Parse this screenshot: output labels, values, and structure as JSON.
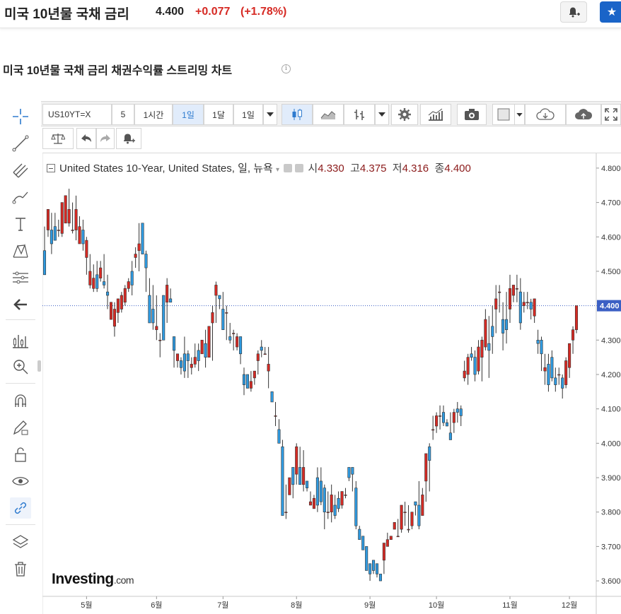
{
  "header": {
    "title": "미국 10년물 국채 금리",
    "price": "4.400",
    "change": "+0.077",
    "change_pct": "(+1.78%)"
  },
  "section": {
    "title": "미국 10년물 국채 금리 채권수익률 스트리밍 차트"
  },
  "toolbar": {
    "symbol": "US10YT=X",
    "interval_5": "5",
    "interval_1h": "1시간",
    "interval_1d": "1일",
    "interval_1m": "1달",
    "range": "1일"
  },
  "legend": {
    "instrument": "United States 10-Year, United States, 일, 뉴욕",
    "open_label": "시",
    "open": "4.330",
    "high_label": "고",
    "high": "4.375",
    "low_label": "저",
    "low": "4.316",
    "close_label": "종",
    "close": "4.400"
  },
  "watermark": {
    "brand": "Investing",
    "domain": ".com"
  },
  "colors": {
    "up": "#d62a24",
    "down": "#2f9ae0",
    "accent": "#1a64c8"
  },
  "chart_data": {
    "type": "candlestick",
    "title": "",
    "ylim": [
      3.555,
      4.845
    ],
    "y_ticks": [
      "3.600",
      "3.700",
      "3.800",
      "3.900",
      "4.000",
      "4.100",
      "4.200",
      "4.300",
      "4.400",
      "4.500",
      "4.600",
      "4.700",
      "4.800"
    ],
    "x_ticks": [
      {
        "label": "5월",
        "index": 12
      },
      {
        "label": "6월",
        "index": 32
      },
      {
        "label": "7월",
        "index": 51
      },
      {
        "label": "8월",
        "index": 72
      },
      {
        "label": "9월",
        "index": 93
      },
      {
        "label": "10월",
        "index": 112
      },
      {
        "label": "11월",
        "index": 133
      },
      {
        "label": "12월",
        "index": 150
      }
    ],
    "last_price": "4.400",
    "series": [
      {
        "ohlc": [
          [
            4.56,
            4.63,
            4.49,
            4.49
          ],
          [
            4.62,
            4.68,
            4.6,
            4.68
          ],
          [
            4.62,
            4.67,
            4.55,
            4.58
          ],
          [
            4.63,
            4.67,
            4.59,
            4.59
          ],
          [
            4.62,
            4.65,
            4.6,
            4.62
          ],
          [
            4.61,
            4.7,
            4.6,
            4.7
          ],
          [
            4.64,
            4.72,
            4.64,
            4.72
          ],
          [
            4.64,
            4.74,
            4.63,
            4.68
          ],
          [
            4.62,
            4.7,
            4.61,
            4.62
          ],
          [
            4.62,
            4.72,
            4.59,
            4.68
          ],
          [
            4.58,
            4.66,
            4.58,
            4.63
          ],
          [
            4.62,
            4.65,
            4.56,
            4.58
          ],
          [
            4.54,
            4.6,
            4.49,
            4.59
          ],
          [
            4.46,
            4.55,
            4.45,
            4.5
          ],
          [
            4.45,
            4.52,
            4.44,
            4.48
          ],
          [
            4.49,
            4.53,
            4.44,
            4.45
          ],
          [
            4.48,
            4.53,
            4.47,
            4.51
          ],
          [
            4.47,
            4.55,
            4.45,
            4.46
          ],
          [
            4.44,
            4.49,
            4.39,
            4.43
          ],
          [
            4.36,
            4.41,
            4.36,
            4.41
          ],
          [
            4.34,
            4.41,
            4.31,
            4.39
          ],
          [
            4.38,
            4.42,
            4.35,
            4.42
          ],
          [
            4.39,
            4.44,
            4.38,
            4.43
          ],
          [
            4.41,
            4.46,
            4.4,
            4.45
          ],
          [
            4.45,
            4.48,
            4.44,
            4.47
          ],
          [
            4.5,
            4.53,
            4.43,
            4.46
          ],
          [
            4.54,
            4.57,
            4.51,
            4.55
          ],
          [
            4.56,
            4.64,
            4.5,
            4.58
          ],
          [
            4.64,
            4.6,
            4.59,
            4.55
          ],
          [
            4.55,
            4.56,
            4.44,
            4.51
          ],
          [
            4.43,
            4.48,
            4.35,
            4.35
          ],
          [
            4.39,
            4.46,
            4.33,
            4.35
          ],
          [
            4.33,
            4.43,
            4.3,
            4.34
          ],
          [
            4.3,
            4.32,
            4.25,
            4.3
          ],
          [
            4.43,
            4.38,
            4.37,
            4.3
          ],
          [
            4.41,
            4.48,
            4.35,
            4.46
          ],
          [
            4.42,
            4.45,
            4.41,
            4.41
          ],
          [
            4.31,
            4.31,
            4.22,
            4.27
          ],
          [
            4.24,
            4.26,
            4.22,
            4.26
          ],
          [
            4.24,
            4.25,
            4.2,
            4.22
          ],
          [
            4.26,
            4.31,
            4.19,
            4.21
          ],
          [
            4.26,
            4.27,
            4.19,
            4.24
          ],
          [
            4.22,
            4.25,
            4.2,
            4.23
          ],
          [
            4.23,
            4.29,
            4.22,
            4.25
          ],
          [
            4.27,
            4.29,
            4.21,
            4.24
          ],
          [
            4.26,
            4.3,
            4.26,
            4.3
          ],
          [
            4.29,
            4.33,
            4.22,
            4.25
          ],
          [
            4.25,
            4.32,
            4.25,
            4.34
          ],
          [
            4.35,
            4.4,
            4.24,
            4.38
          ],
          [
            4.43,
            4.47,
            4.35,
            4.46
          ],
          [
            4.43,
            4.43,
            4.39,
            4.42
          ],
          [
            4.39,
            4.44,
            4.33,
            4.33
          ],
          [
            4.38,
            4.4,
            4.3,
            4.38
          ],
          [
            4.31,
            4.35,
            4.29,
            4.3
          ],
          [
            4.32,
            4.33,
            4.27,
            4.32
          ],
          [
            4.28,
            4.32,
            4.27,
            4.31
          ],
          [
            4.31,
            4.31,
            4.23,
            4.26
          ],
          [
            4.2,
            4.22,
            4.14,
            4.17
          ],
          [
            4.2,
            4.2,
            4.16,
            4.16
          ],
          [
            4.16,
            4.21,
            4.15,
            4.18
          ],
          [
            4.19,
            4.21,
            4.17,
            4.21
          ],
          [
            4.24,
            4.27,
            4.2,
            4.26
          ],
          [
            4.28,
            4.3,
            4.25,
            4.27
          ],
          [
            4.26,
            4.28,
            4.26,
            4.26
          ],
          [
            4.21,
            4.28,
            4.16,
            4.23
          ],
          [
            4.15,
            4.13,
            4.13,
            4.12
          ],
          [
            4.08,
            4.12,
            4.05,
            4.08
          ],
          [
            4.04,
            4.07,
            4.04,
            4.0
          ],
          [
            3.99,
            4.01,
            3.97,
            3.79
          ],
          [
            3.8,
            3.88,
            3.78,
            3.8
          ],
          [
            3.85,
            3.86,
            3.88,
            3.9
          ],
          [
            3.93,
            3.9,
            3.84,
            3.88
          ],
          [
            3.91,
            4.0,
            3.88,
            3.99
          ],
          [
            3.93,
            3.99,
            3.94,
            3.88
          ],
          [
            3.88,
            3.98,
            3.86,
            3.93
          ],
          [
            3.89,
            3.89,
            3.86,
            3.87
          ],
          [
            3.82,
            3.86,
            3.84,
            3.83
          ],
          [
            3.81,
            3.85,
            3.81,
            3.84
          ],
          [
            3.9,
            3.93,
            3.8,
            3.82
          ],
          [
            3.89,
            3.93,
            3.82,
            3.83
          ],
          [
            3.87,
            3.88,
            3.75,
            3.8
          ],
          [
            3.8,
            3.86,
            3.78,
            3.8
          ],
          [
            3.8,
            3.88,
            3.77,
            3.85
          ],
          [
            3.82,
            3.85,
            3.78,
            3.79
          ],
          [
            3.84,
            3.86,
            3.8,
            3.81
          ],
          [
            3.82,
            3.86,
            3.81,
            3.86
          ],
          [
            3.85,
            3.87,
            3.84,
            3.85
          ],
          [
            3.93,
            3.93,
            3.89,
            3.9
          ],
          [
            3.93,
            3.9,
            3.86,
            3.91
          ],
          [
            3.87,
            3.89,
            3.75,
            3.76
          ],
          [
            3.75,
            3.76,
            3.72,
            3.72
          ],
          [
            3.73,
            3.73,
            3.69,
            3.69
          ],
          [
            3.7,
            3.69,
            3.64,
            3.63
          ],
          [
            3.65,
            3.65,
            3.6,
            3.62
          ],
          [
            3.66,
            3.65,
            3.62,
            3.63
          ],
          [
            3.65,
            3.63,
            3.61,
            3.62
          ],
          [
            3.62,
            3.62,
            3.61,
            3.6
          ],
          [
            3.66,
            3.71,
            3.62,
            3.71
          ],
          [
            3.7,
            3.74,
            3.7,
            3.72
          ],
          [
            3.72,
            3.71,
            3.73,
            3.73
          ],
          [
            3.75,
            3.75,
            3.75,
            3.77
          ],
          [
            3.73,
            3.78,
            3.73,
            3.73
          ],
          [
            3.75,
            3.78,
            3.74,
            3.82
          ],
          [
            3.8,
            3.83,
            3.76,
            3.8
          ],
          [
            3.75,
            3.82,
            3.74,
            3.75
          ],
          [
            3.76,
            3.73,
            3.75,
            3.8
          ],
          [
            3.83,
            3.81,
            3.79,
            3.82
          ],
          [
            3.82,
            3.89,
            3.75,
            3.76
          ],
          [
            3.79,
            3.87,
            3.81,
            3.85
          ],
          [
            3.89,
            3.86,
            3.83,
            3.97
          ],
          [
            3.99,
            4.0,
            3.86,
            3.95
          ],
          [
            4.04,
            4.08,
            4.01,
            4.04
          ],
          [
            4.05,
            4.09,
            4.03,
            4.08
          ],
          [
            4.08,
            4.11,
            4.04,
            4.08
          ],
          [
            4.09,
            4.11,
            4.05,
            4.06
          ],
          [
            4.06,
            4.07,
            4.05,
            4.05
          ],
          [
            4.03,
            4.09,
            4.03,
            4.01
          ],
          [
            4.06,
            4.1,
            4.03,
            4.09
          ],
          [
            4.1,
            4.12,
            4.06,
            4.09
          ],
          [
            4.1,
            4.11,
            4.05,
            4.08
          ],
          [
            4.19,
            4.24,
            4.18,
            4.21
          ],
          [
            4.2,
            4.26,
            4.17,
            4.25
          ],
          [
            4.26,
            4.28,
            4.24,
            4.25
          ],
          [
            4.25,
            4.27,
            4.18,
            4.2
          ],
          [
            4.21,
            4.3,
            4.2,
            4.28
          ],
          [
            4.25,
            4.31,
            4.18,
            4.3
          ],
          [
            4.28,
            4.39,
            4.27,
            4.36
          ],
          [
            4.29,
            4.37,
            4.19,
            4.27
          ],
          [
            4.34,
            4.4,
            4.26,
            4.31
          ],
          [
            4.39,
            4.46,
            4.32,
            4.42
          ],
          [
            4.44,
            4.46,
            4.38,
            4.44
          ],
          [
            4.36,
            4.41,
            4.27,
            4.32
          ],
          [
            4.36,
            4.44,
            4.29,
            4.33
          ],
          [
            4.39,
            4.49,
            4.35,
            4.45
          ],
          [
            4.43,
            4.46,
            4.41,
            4.46
          ],
          [
            4.45,
            4.49,
            4.41,
            4.45
          ],
          [
            4.44,
            4.48,
            4.33,
            4.35
          ],
          [
            4.4,
            4.44,
            4.38,
            4.41
          ],
          [
            4.41,
            4.44,
            4.39,
            4.41
          ],
          [
            4.41,
            4.42,
            4.36,
            4.39
          ],
          [
            4.37,
            4.42,
            4.35,
            4.42
          ],
          [
            4.3,
            4.33,
            4.26,
            4.29
          ],
          [
            4.3,
            4.31,
            4.21,
            4.26
          ],
          [
            4.21,
            4.26,
            4.17,
            4.22
          ],
          [
            4.23,
            4.26,
            4.15,
            4.17
          ],
          [
            4.25,
            4.27,
            4.18,
            4.19
          ],
          [
            4.19,
            4.22,
            4.15,
            4.17
          ],
          [
            4.2,
            4.22,
            4.17,
            4.2
          ],
          [
            4.19,
            4.2,
            4.13,
            4.16
          ],
          [
            4.17,
            4.25,
            4.16,
            4.24
          ],
          [
            4.22,
            4.27,
            4.19,
            4.29
          ],
          [
            4.3,
            4.34,
            4.26,
            4.33
          ],
          [
            4.33,
            4.4,
            4.32,
            4.4
          ]
        ]
      }
    ]
  }
}
